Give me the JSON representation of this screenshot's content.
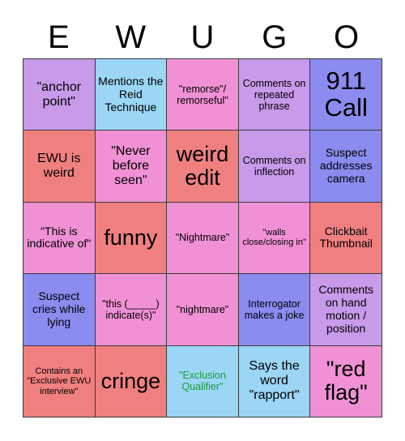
{
  "header": {
    "letters": [
      "E",
      "W",
      "U",
      "G",
      "O"
    ]
  },
  "palette": {
    "purple": "#c89aea",
    "lightblue": "#9bd6f5",
    "pink": "#f091d5",
    "blue": "#8b8bf0",
    "salmon": "#f08080",
    "border": "#3a3a3a",
    "text": "#000000",
    "green_text": "#1a9d3a",
    "background": "#ffffff"
  },
  "grid": {
    "rows": 5,
    "columns": 5,
    "cells": [
      {
        "text": "\"anchor point\"",
        "color": "purple",
        "size": "lg",
        "text_color": "#000000"
      },
      {
        "text": "Mentions the Reid Technique",
        "color": "lightblue",
        "size": "md",
        "text_color": "#000000"
      },
      {
        "text": "\"remorse\"/ remorseful\"",
        "color": "pink",
        "size": "sm",
        "text_color": "#000000"
      },
      {
        "text": "Comments on repeated phrase",
        "color": "purple",
        "size": "sm",
        "text_color": "#000000"
      },
      {
        "text": "911 Call",
        "color": "blue",
        "size": "huge",
        "text_color": "#000000"
      },
      {
        "text": "EWU is weird",
        "color": "salmon",
        "size": "lg",
        "text_color": "#000000"
      },
      {
        "text": "\"Never before seen\"",
        "color": "pink",
        "size": "lg",
        "text_color": "#000000"
      },
      {
        "text": "weird edit",
        "color": "salmon",
        "size": "xxl",
        "text_color": "#000000"
      },
      {
        "text": "Comments on inflection",
        "color": "purple",
        "size": "sm",
        "text_color": "#000000"
      },
      {
        "text": "Suspect addresses camera",
        "color": "blue",
        "size": "md",
        "text_color": "#000000"
      },
      {
        "text": "\"This is indicative of\"",
        "color": "pink",
        "size": "md",
        "text_color": "#000000"
      },
      {
        "text": "funny",
        "color": "salmon",
        "size": "xxl",
        "text_color": "#000000"
      },
      {
        "text": "\"Nightmare\"",
        "color": "pink",
        "size": "sm",
        "text_color": "#000000"
      },
      {
        "text": "\"walls close/closing in\"",
        "color": "pink",
        "size": "xs",
        "text_color": "#000000"
      },
      {
        "text": "Clickbait Thumbnail",
        "color": "salmon",
        "size": "md",
        "text_color": "#000000"
      },
      {
        "text": "Suspect cries while lying",
        "color": "blue",
        "size": "md",
        "text_color": "#000000"
      },
      {
        "text": "\"this (_____) indicate(s)\"",
        "color": "pink",
        "size": "sm",
        "text_color": "#000000"
      },
      {
        "text": "\"nightmare\"",
        "color": "pink",
        "size": "sm",
        "text_color": "#000000"
      },
      {
        "text": "Interrogator makes a joke",
        "color": "blue",
        "size": "sm",
        "text_color": "#000000"
      },
      {
        "text": "Comments on hand motion / position",
        "color": "purple",
        "size": "md",
        "text_color": "#000000"
      },
      {
        "text": "Contains an \"Exclusive EWU interview\"",
        "color": "salmon",
        "size": "xs",
        "text_color": "#000000"
      },
      {
        "text": "cringe",
        "color": "salmon",
        "size": "xxl",
        "text_color": "#000000"
      },
      {
        "text": "\"Exclusion Qualifier\"",
        "color": "lightblue",
        "size": "sm",
        "text_color": "#1a9d3a"
      },
      {
        "text": "Says the word \"rapport\"",
        "color": "lightblue",
        "size": "lg",
        "text_color": "#000000"
      },
      {
        "text": "\"red flag\"",
        "color": "pink",
        "size": "xxl",
        "text_color": "#000000"
      }
    ]
  }
}
